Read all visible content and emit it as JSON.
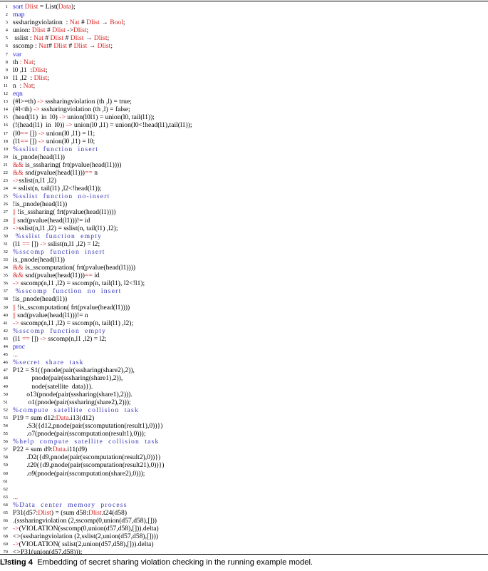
{
  "colors": {
    "keyword": "#1f1fd0",
    "type": "#d81e1e",
    "comment": "#3a3ab8",
    "default": "#000000"
  },
  "listing": {
    "lines": [
      [
        [
          "kw",
          "sort "
        ],
        [
          "ty",
          "Dlist"
        ],
        [
          "p",
          " = List("
        ],
        [
          "ty",
          "Data"
        ],
        [
          "p",
          ");"
        ]
      ],
      [
        [
          "kw",
          "map"
        ]
      ],
      [
        [
          "p",
          "sssharingviolation  : "
        ],
        [
          "ty",
          "Nat"
        ],
        [
          "p",
          " # "
        ],
        [
          "ty",
          "Dlist"
        ],
        [
          "p",
          " → "
        ],
        [
          "ty",
          "Bool"
        ],
        [
          "p",
          ";"
        ]
      ],
      [
        [
          "p",
          "union: "
        ],
        [
          "ty",
          "Dlist"
        ],
        [
          "p",
          " # "
        ],
        [
          "ty",
          "Dlist"
        ],
        [
          "p",
          " ->"
        ],
        [
          "ty",
          "Dlist"
        ],
        [
          "p",
          ";"
        ]
      ],
      [
        [
          "p",
          " sslist : "
        ],
        [
          "ty",
          "Nat"
        ],
        [
          "p",
          " # "
        ],
        [
          "ty",
          "Dlist"
        ],
        [
          "p",
          " # "
        ],
        [
          "ty",
          "Dlist"
        ],
        [
          "p",
          " → "
        ],
        [
          "ty",
          "Dlist"
        ],
        [
          "p",
          ";"
        ]
      ],
      [
        [
          "p",
          "sscomp : "
        ],
        [
          "ty",
          "Nat"
        ],
        [
          "p",
          "# "
        ],
        [
          "ty",
          "Dlist"
        ],
        [
          "p",
          " # "
        ],
        [
          "ty",
          "Dlist"
        ],
        [
          "p",
          " → "
        ],
        [
          "ty",
          "Dlist"
        ],
        [
          "p",
          ";"
        ]
      ],
      [
        [
          "kw",
          "var"
        ]
      ],
      [
        [
          "p",
          "th "
        ],
        [
          "ty",
          ": Nat"
        ],
        [
          "p",
          ";"
        ]
      ],
      [
        [
          "p",
          "l0 ,l1  :"
        ],
        [
          "ty",
          "Dlist"
        ],
        [
          "p",
          ";"
        ]
      ],
      [
        [
          "p",
          "l1 ,l2  : "
        ],
        [
          "ty",
          "Dlist"
        ],
        [
          "p",
          ";"
        ]
      ],
      [
        [
          "p",
          "n  : "
        ],
        [
          "ty",
          "Nat"
        ],
        [
          "p",
          ";"
        ]
      ],
      [
        [
          "kw",
          "eqn"
        ]
      ],
      [
        [
          "p",
          "(#l>=th) "
        ],
        [
          "ty",
          "->"
        ],
        [
          "p",
          " sssharingviolation (th ,l) = true;"
        ]
      ],
      [
        [
          "p",
          "(#l<th) "
        ],
        [
          "ty",
          "->"
        ],
        [
          "p",
          " sssharingviolation (th ,l) = false;"
        ]
      ],
      [
        [
          "p",
          "(head(l1)  in  l0) "
        ],
        [
          "ty",
          "->"
        ],
        [
          "p",
          " union(l0l1) = union(l0, tail(l1));"
        ]
      ],
      [
        [
          "p",
          "(!(head(l1)  in  l0)) "
        ],
        [
          "ty",
          "->"
        ],
        [
          "p",
          " union(l0 ,l1) = union(l0<!head(l1),tail(l1));"
        ]
      ],
      [
        [
          "p",
          "(l0"
        ],
        [
          "ty",
          "=="
        ],
        [
          "p",
          " []) "
        ],
        [
          "ty",
          "->"
        ],
        [
          "p",
          " union(l0 ,l1) = l1;"
        ]
      ],
      [
        [
          "p",
          "(l1"
        ],
        [
          "ty",
          "=="
        ],
        [
          "p",
          " []) "
        ],
        [
          "ty",
          "->"
        ],
        [
          "p",
          " union(l0 ,l1) = l0;"
        ]
      ],
      [
        [
          "c",
          "%sslist  function  insert"
        ]
      ],
      [
        [
          "p",
          "is_pnode(head(l1))"
        ]
      ],
      [
        [
          "ty",
          "&&"
        ],
        [
          "p",
          " is_sssharing( frt(pvalue(head(l1))))"
        ]
      ],
      [
        [
          "ty",
          "&&"
        ],
        [
          "p",
          " snd(pvalue(head(l1)))"
        ],
        [
          "ty",
          "=="
        ],
        [
          "p",
          " n"
        ]
      ],
      [
        [
          "ty",
          "->"
        ],
        [
          "p",
          "sslist(n,l1 ,l2)"
        ]
      ],
      [
        [
          "p",
          "= sslist(n, tail(l1) ,l2<!head(l1));"
        ]
      ],
      [
        [
          "c",
          "%sslist  function  no-insert"
        ]
      ],
      [
        [
          "p",
          "!is_pnode(head(l1))"
        ]
      ],
      [
        [
          "ty",
          "||"
        ],
        [
          "p",
          " !is_sssharing( frt(pvalue(head(l1))))"
        ]
      ],
      [
        [
          "ty",
          "||"
        ],
        [
          "p",
          " snd(pvalue(head(l1)))!= id"
        ]
      ],
      [
        [
          "ty",
          "->"
        ],
        [
          "p",
          "sslist(n,l1 ,l2) = sslist(n, tail(l1) ,l2);"
        ]
      ],
      [
        [
          "c",
          " %sslist  function  empty"
        ]
      ],
      [
        [
          "p",
          "(l1 "
        ],
        [
          "ty",
          "=="
        ],
        [
          "p",
          " []) "
        ],
        [
          "ty",
          "->"
        ],
        [
          "p",
          " sslist(n,l1 ,l2) = l2;"
        ]
      ],
      [
        [
          "c",
          "%sscomp  function  insert"
        ]
      ],
      [
        [
          "p",
          "is_pnode(head(l1))"
        ]
      ],
      [
        [
          "ty",
          "&&"
        ],
        [
          "p",
          " is_sscomputation( frt(pvalue(head(l1))))"
        ]
      ],
      [
        [
          "ty",
          "&&"
        ],
        [
          "p",
          " snd(pvalue(head(l1)))"
        ],
        [
          "ty",
          "=="
        ],
        [
          "p",
          " id"
        ]
      ],
      [
        [
          "ty",
          "->"
        ],
        [
          "p",
          " sscomp(n,l1 ,l2) = sscomp(n, tail(l1), l2<!l1);"
        ]
      ],
      [
        [
          "c",
          " %sscomp  function  no  insert"
        ]
      ],
      [
        [
          "p",
          "!is_pnode(head(l1))"
        ]
      ],
      [
        [
          "ty",
          "||"
        ],
        [
          "p",
          " !is_sscomputation( frt(pvalue(head(l1))))"
        ]
      ],
      [
        [
          "ty",
          "||"
        ],
        [
          "p",
          " snd(pvalue(head(l1)))!= n"
        ]
      ],
      [
        [
          "ty",
          "->"
        ],
        [
          "p",
          " sscomp(n,l1 ,l2) = sscomp(n, tail(l1) ,l2);"
        ]
      ],
      [
        [
          "c",
          "%sscomp  function  empty"
        ]
      ],
      [
        [
          "p",
          "(l1 "
        ],
        [
          "ty",
          "=="
        ],
        [
          "p",
          " []) "
        ],
        [
          "ty",
          "->"
        ],
        [
          "p",
          " sscomp(n,l1 ,l2) = l2;"
        ]
      ],
      [
        [
          "kw",
          "proc"
        ]
      ],
      [
        [
          "ty",
          "..."
        ]
      ],
      [
        [
          "c",
          "%secret  share  task"
        ]
      ],
      [
        [
          "p",
          "P12 = S1({pnode(pair(sssharing(share2),2)),"
        ]
      ],
      [
        [
          "p",
          "           pnode(pair(sssharing(share1),2)),"
        ]
      ],
      [
        [
          "p",
          "           node(satellite  data)})."
        ]
      ],
      [
        [
          "p",
          "        o13(pnode(pair(sssharing(share1),2)))."
        ]
      ],
      [
        [
          "p",
          "         o1(pnode(pair(sssharing(share2),2)));"
        ]
      ],
      [
        [
          "c",
          "%compute  satellite  collision  task"
        ]
      ],
      [
        [
          "p",
          "P19 = sum d12:"
        ],
        [
          "ty",
          "Data"
        ],
        [
          "p",
          ".i13(d12)"
        ]
      ],
      [
        [
          "p",
          "        .S3({d12,pnode(pair(sscomputation(result1),0))})"
        ]
      ],
      [
        [
          "p",
          "        .o7(pnode(pair(sscomputation(result1),0)));"
        ]
      ],
      [
        [
          "c",
          "%help  compute  satellite  collision  task"
        ]
      ],
      [
        [
          "p",
          "P22 = sum d9:"
        ],
        [
          "ty",
          "Data"
        ],
        [
          "p",
          ".i11(d9)"
        ]
      ],
      [
        [
          "p",
          "        .D2({d9,pnode(pair(sscomputation(result2),0))})"
        ]
      ],
      [
        [
          "p",
          "        .t20({d9,pnode(pair(sscomputation(result21),0))})"
        ]
      ],
      [
        [
          "p",
          "        .o9(pnode(pair(sscomputation(share2),0)));"
        ]
      ],
      [
        [
          "p",
          ""
        ]
      ],
      [
        [
          "p",
          ""
        ]
      ],
      [
        [
          "ty",
          "..."
        ]
      ],
      [
        [
          "c",
          "%Data  center  memory  process"
        ]
      ],
      [
        [
          "p",
          "P31(d57:"
        ],
        [
          "ty",
          "Dlist"
        ],
        [
          "p",
          ") = (sum d58:"
        ],
        [
          "ty",
          "Dlist"
        ],
        [
          "p",
          ".t24(d58)"
        ]
      ],
      [
        [
          "p",
          ".(sssharingviolation (2,sscomp(0,union(d57,d58),[]))"
        ]
      ],
      [
        [
          "ty",
          "->"
        ],
        [
          "p",
          "(VIOLATION(sscomp(0,union(d57,d58),[])).delta)"
        ]
      ],
      [
        [
          "p",
          "<>(sssharingviolation (2,sslist(2,union(d57,d58),[])))"
        ]
      ],
      [
        [
          "ty",
          "->"
        ],
        [
          "p",
          "(VIOLATION( sslist(2,union(d57,d58),[])).delta)"
        ]
      ],
      [
        [
          "p",
          "<>P31(union(d57,d58)));"
        ]
      ],
      [
        [
          "ty",
          "..."
        ]
      ]
    ]
  },
  "caption": {
    "label": "Listing 4",
    "text": "Embedding of secret sharing violation checking in the running example model."
  }
}
